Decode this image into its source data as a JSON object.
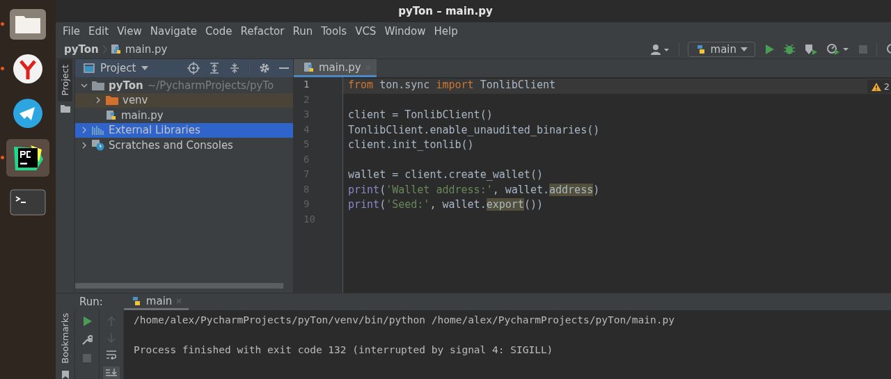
{
  "dock": [
    {
      "kind": "files",
      "running": true,
      "selected": false
    },
    {
      "kind": "browser",
      "running": true,
      "selected": false
    },
    {
      "kind": "telegram",
      "running": false,
      "selected": false
    },
    {
      "kind": "pycharm",
      "running": true,
      "selected": true
    },
    {
      "kind": "terminal",
      "running": false,
      "selected": false
    }
  ],
  "window": {
    "title": "pyTon – main.py"
  },
  "menu": [
    "File",
    "Edit",
    "View",
    "Navigate",
    "Code",
    "Refactor",
    "Run",
    "Tools",
    "VCS",
    "Window",
    "Help"
  ],
  "breadcrumbs": [
    {
      "label": "pyTon",
      "kind": "project"
    },
    {
      "label": "main.py",
      "kind": "python-file"
    }
  ],
  "run_config": {
    "label": "main"
  },
  "left_stripe": {
    "label": "Project"
  },
  "project_panel": {
    "title": "Project",
    "tree": [
      {
        "label": "pyTon",
        "hint": "~/PycharmProjects/pyTo",
        "kind": "folder",
        "expanded": true,
        "selected": false,
        "children": [
          {
            "label": "venv",
            "kind": "excluded-folder",
            "expanded": false,
            "selected": false
          },
          {
            "label": "main.py",
            "kind": "python-file",
            "selected": false
          }
        ]
      },
      {
        "label": "External Libraries",
        "kind": "libraries",
        "expanded": false,
        "selected": true
      },
      {
        "label": "Scratches and Consoles",
        "kind": "scratches",
        "expanded": false,
        "selected": false
      }
    ]
  },
  "editor": {
    "tabs": [
      {
        "label": "main.py",
        "selected": true
      }
    ],
    "warnings": "2",
    "lines": [
      {
        "number": "1",
        "current": true,
        "tokens": [
          {
            "kind": "keyword",
            "text": "from"
          },
          {
            "kind": "plain",
            "text": " ton.sync "
          },
          {
            "kind": "keyword",
            "text": "import"
          },
          {
            "kind": "plain",
            "text": " TonlibClient"
          }
        ]
      },
      {
        "number": "2",
        "current": false
      },
      {
        "number": "3",
        "current": false,
        "tokens": [
          {
            "kind": "plain",
            "text": "client = TonlibClient()"
          }
        ]
      },
      {
        "number": "4",
        "current": false,
        "tokens": [
          {
            "kind": "plain",
            "text": "TonlibClient.enable_unaudited_binaries()"
          }
        ]
      },
      {
        "number": "5",
        "current": false,
        "tokens": [
          {
            "kind": "plain",
            "text": "client.init_tonlib()"
          }
        ]
      },
      {
        "number": "6",
        "current": false
      },
      {
        "number": "7",
        "current": false,
        "tokens": [
          {
            "kind": "plain",
            "text": "wallet = client.create_wallet()"
          }
        ]
      },
      {
        "number": "8",
        "current": false,
        "tokens": [
          {
            "kind": "builtin",
            "text": "print"
          },
          {
            "kind": "plain",
            "text": "("
          },
          {
            "kind": "string",
            "text": "'Wallet address:'"
          },
          {
            "kind": "plain",
            "text": ", wallet."
          },
          {
            "kind": "highlight",
            "text": "address"
          },
          {
            "kind": "plain",
            "text": ")"
          }
        ]
      },
      {
        "number": "9",
        "current": false,
        "tokens": [
          {
            "kind": "builtin",
            "text": "print"
          },
          {
            "kind": "plain",
            "text": "("
          },
          {
            "kind": "string",
            "text": "'Seed:'"
          },
          {
            "kind": "plain",
            "text": ", wallet."
          },
          {
            "kind": "highlight",
            "text": "export"
          },
          {
            "kind": "plain",
            "text": "())"
          }
        ]
      },
      {
        "number": "10",
        "current": false
      }
    ]
  },
  "run_panel": {
    "label": "Run:",
    "tabs": [
      {
        "label": "main",
        "selected": true
      }
    ],
    "stripe_label": "Bookmarks",
    "output": [
      "/home/alex/PycharmProjects/pyTon/venv/bin/python /home/alex/PycharmProjects/pyTon/main.py",
      "Process finished with exit code 132 (interrupted by signal 4: SIGILL)"
    ]
  }
}
